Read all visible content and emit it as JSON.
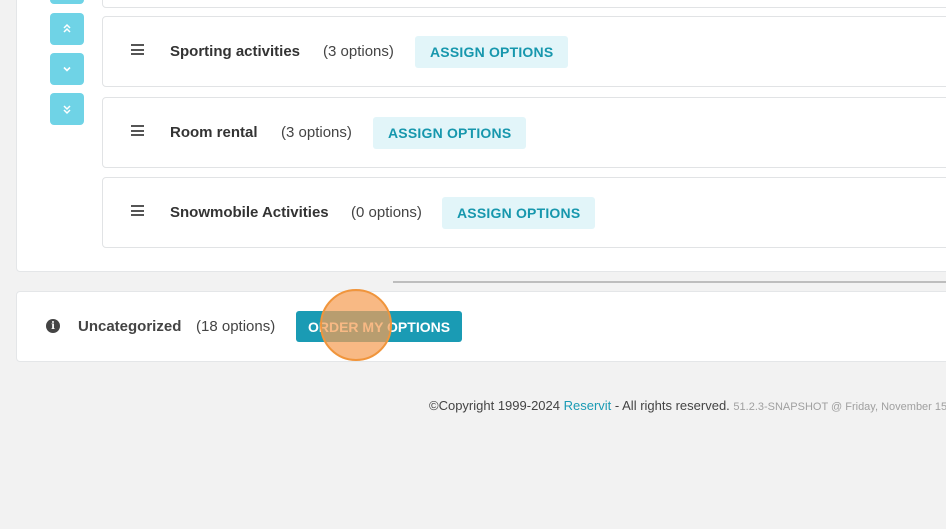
{
  "categories": [
    {
      "name": "Sporting activities",
      "count": "(3 options)",
      "button": "ASSIGN OPTIONS"
    },
    {
      "name": "Room rental",
      "count": "(3 options)",
      "button": "ASSIGN OPTIONS"
    },
    {
      "name": "Snowmobile Activities",
      "count": "(0 options)",
      "button": "ASSIGN OPTIONS"
    }
  ],
  "uncategorized": {
    "name": "Uncategorized",
    "count": "(18 options)",
    "button": "ORDER MY OPTIONS"
  },
  "footer": {
    "copyright": "©Copyright 1999-2024 ",
    "brand": "Reservit",
    "rights": " - All rights reserved. ",
    "version": "51.2.3-SNAPSHOT @ Friday, November 15,"
  },
  "colors": {
    "accent": "#1a9bb4",
    "move_buttons": "#6fd3e6",
    "assign_bg": "#e2f5f9",
    "click_marker": "#f59e55"
  },
  "icons": [
    "move-top-icon",
    "move-up-icon",
    "move-down-icon",
    "move-bottom-icon",
    "drag-handle-icon",
    "info-icon"
  ]
}
